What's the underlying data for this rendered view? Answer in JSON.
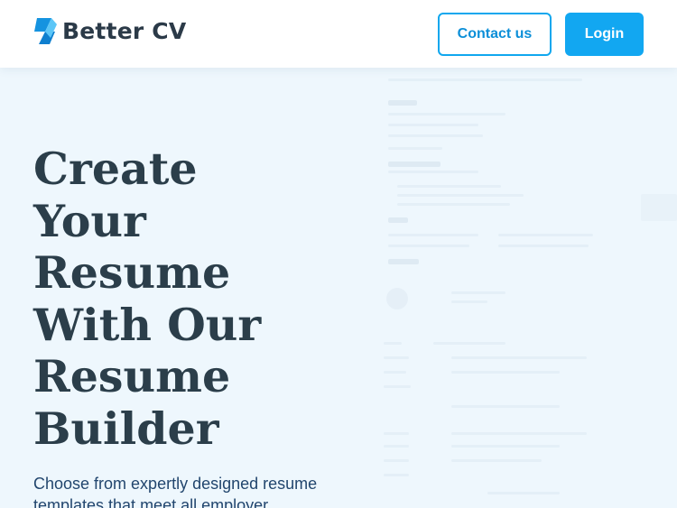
{
  "brand": {
    "name": "Better CV",
    "logo_icon": "better-cv-logo-icon"
  },
  "nav": {
    "contact_label": "Contact us",
    "login_label": "Login"
  },
  "hero": {
    "headline_lines": [
      "Create",
      "Your",
      "Resume",
      "With Our",
      "Resume",
      "Builder"
    ],
    "subtext": "Choose from expertly designed resume templates that meet all employer"
  },
  "colors": {
    "accent": "#12a7f1",
    "heading": "#2b3e4a",
    "body_text": "#22466e",
    "background": "#eef7fd"
  }
}
